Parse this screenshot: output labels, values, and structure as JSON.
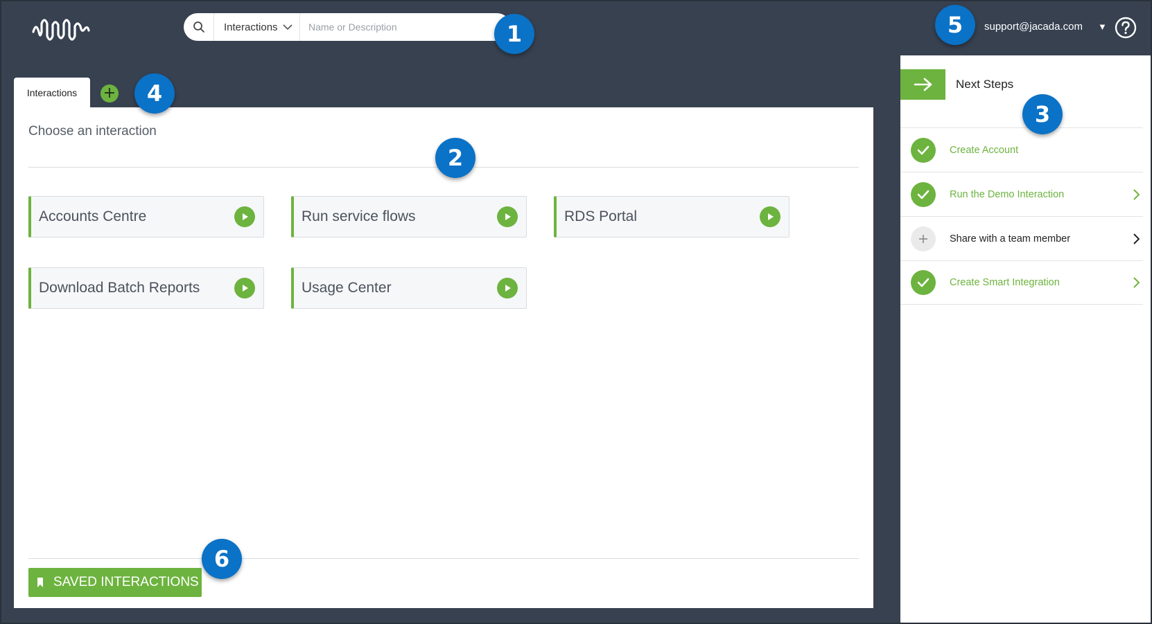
{
  "header": {
    "search": {
      "scope": "Interactions",
      "placeholder": "Name or Description",
      "value": ""
    },
    "user_email": "support@jacada.com",
    "user_caret": "▼"
  },
  "tabs": [
    {
      "label": "Interactions",
      "active": true
    }
  ],
  "add_tab_symbol": "+",
  "main": {
    "title": "Choose an interaction",
    "interactions": [
      {
        "label": "Accounts Centre"
      },
      {
        "label": "Run service flows"
      },
      {
        "label": "RDS Portal"
      },
      {
        "label": "Download Batch Reports"
      },
      {
        "label": "Usage Center"
      }
    ],
    "saved_button": "SAVED INTERACTIONS"
  },
  "sidebar": {
    "title": "Next Steps",
    "steps": [
      {
        "label": "Create Account",
        "status": "done",
        "chevron": false
      },
      {
        "label": "Run the Demo Interaction",
        "status": "done",
        "chevron": true
      },
      {
        "label": "Share with a team member",
        "status": "todo",
        "chevron": true
      },
      {
        "label": "Create Smart Integration",
        "status": "done",
        "chevron": true
      }
    ]
  },
  "callouts": [
    "1",
    "2",
    "3",
    "4",
    "5",
    "6"
  ],
  "colors": {
    "background": "#374150",
    "accent_green": "#6db33f",
    "callout_blue": "#0a72c7"
  },
  "icons": [
    "logo-icon",
    "search-icon",
    "chevron-down-icon",
    "help-icon",
    "play-icon",
    "arrow-right-icon",
    "check-icon",
    "plus-icon",
    "chevron-right-icon",
    "bookmark-icon"
  ]
}
